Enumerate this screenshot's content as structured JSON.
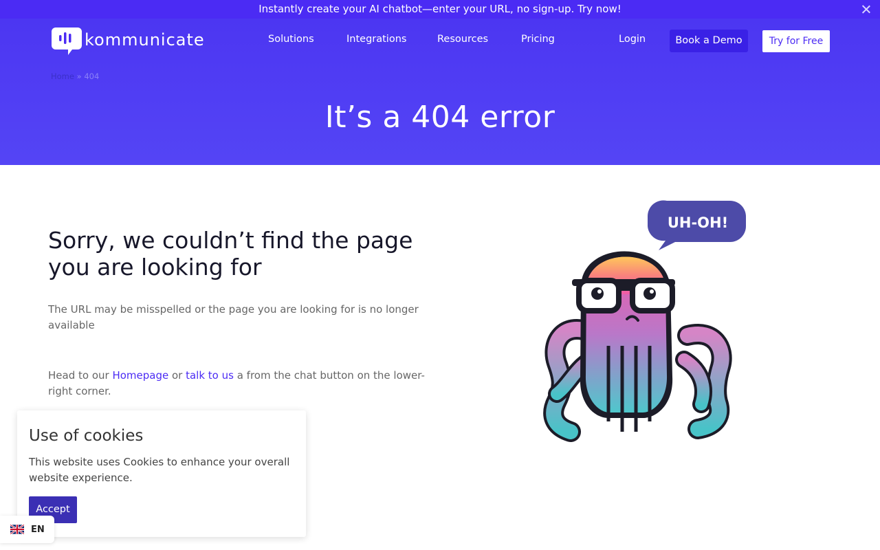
{
  "announcement": {
    "text": "Instantly create your AI chatbot—enter your URL, no sign-up. Try now!"
  },
  "header": {
    "logo_text": "kommunicate",
    "nav": [
      "Solutions",
      "Integrations",
      "Resources",
      "Pricing"
    ],
    "login": "Login",
    "book_demo": "Book a Demo",
    "try_free": "Try for Free"
  },
  "breadcrumb": {
    "home": "Home",
    "separator": "»",
    "current": "404"
  },
  "hero": {
    "title": "It’s a 404 error"
  },
  "main": {
    "heading": "Sorry, we couldn’t find the page you are looking for",
    "description": "The URL may be misspelled or the page you are looking for is no longer available",
    "help_prefix": "Head to our ",
    "homepage_link": "Homepage",
    "help_or": " or ",
    "talk_link": "talk to us",
    "help_suffix": " a from the chat button on the lower-right corner."
  },
  "illustration": {
    "bubble_text": "UH-OH!"
  },
  "cookie": {
    "title": "Use of cookies",
    "text": "This website uses Cookies to enhance your overall website experience.",
    "accept": "Accept"
  },
  "language": {
    "code": "EN"
  },
  "colors": {
    "brand": "#4b2bf4",
    "hero_bg": "#5040f4",
    "bubble": "#4d4ba8"
  }
}
